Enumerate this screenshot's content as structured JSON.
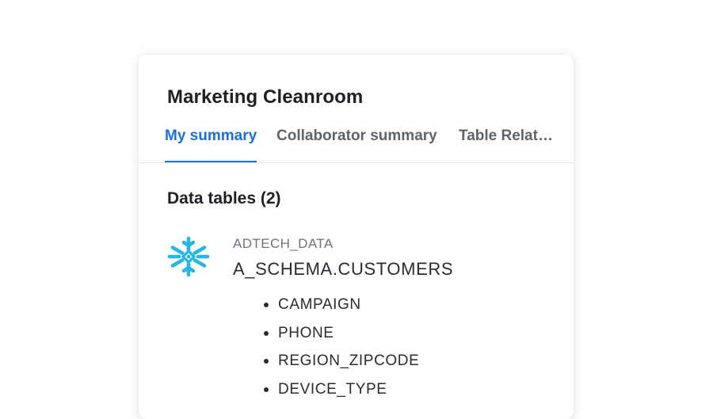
{
  "card": {
    "title": "Marketing Cleanroom",
    "tabs": [
      {
        "label": "My summary",
        "active": true
      },
      {
        "label": "Collaborator summary",
        "active": false
      },
      {
        "label": "Table Relat…",
        "active": false
      }
    ],
    "section_heading": "Data tables (2)",
    "table": {
      "icon": "snowflake-icon",
      "database": "ADTECH_DATA",
      "name": "A_SCHEMA.CUSTOMERS",
      "columns": [
        "CAMPAIGN",
        "PHONE",
        "REGION_ZIPCODE",
        "DEVICE_TYPE"
      ]
    }
  },
  "colors": {
    "accent": "#1a6fdd",
    "snowflake": "#29b5e8",
    "text": "#1f1f24",
    "muted": "#6b7280"
  }
}
